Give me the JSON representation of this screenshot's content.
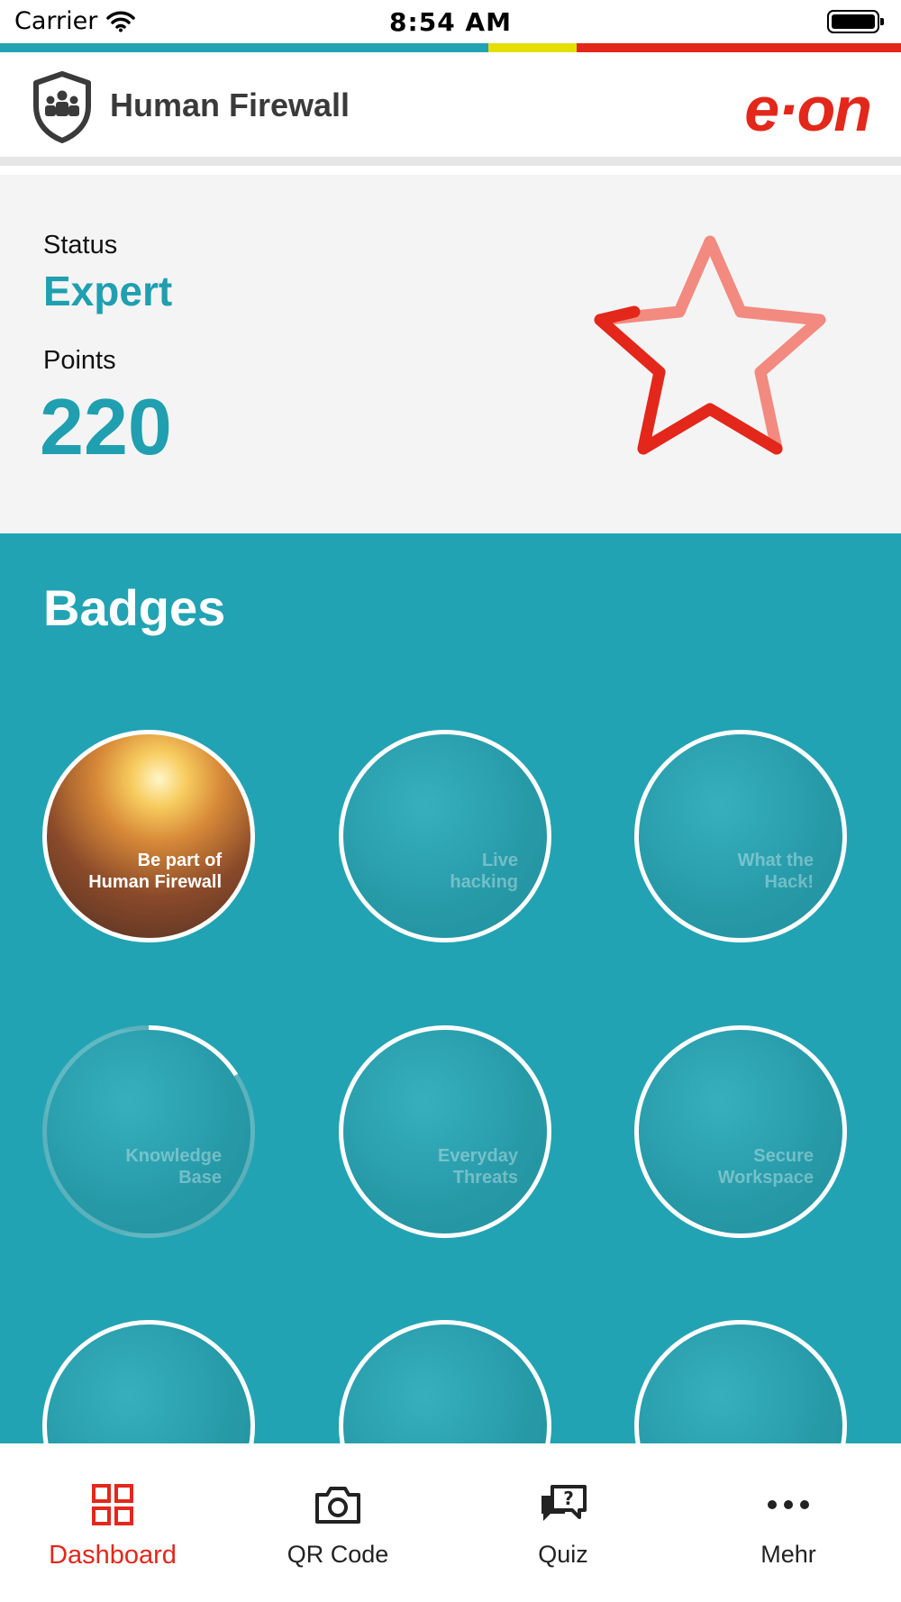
{
  "status_bar": {
    "carrier": "Carrier",
    "time": "8:54 AM"
  },
  "colors": {
    "accent": "#22a3b3",
    "brand_red": "#e3271b",
    "brand_yellow": "#e4df00",
    "star_light": "#f28a80"
  },
  "header": {
    "app_title": "Human Firewall",
    "brand": "e·on"
  },
  "status": {
    "status_label": "Status",
    "status_value": "Expert",
    "points_label": "Points",
    "points_value": "220"
  },
  "badges": {
    "title": "Badges",
    "items": [
      {
        "line1": "Be part of",
        "line2": "Human Firewall"
      },
      {
        "line1": "Live",
        "line2": "hacking"
      },
      {
        "line1": "What the",
        "line2": "Hack!"
      },
      {
        "line1": "Knowledge",
        "line2": "Base"
      },
      {
        "line1": "Everyday",
        "line2": "Threats"
      },
      {
        "line1": "Secure",
        "line2": "Workspace"
      }
    ]
  },
  "tabbar": {
    "tabs": [
      {
        "label": "Dashboard",
        "icon": "grid-icon"
      },
      {
        "label": "QR Code",
        "icon": "camera-icon"
      },
      {
        "label": "Quiz",
        "icon": "chat-question-icon"
      },
      {
        "label": "Mehr",
        "icon": "more-dots-icon"
      }
    ]
  }
}
